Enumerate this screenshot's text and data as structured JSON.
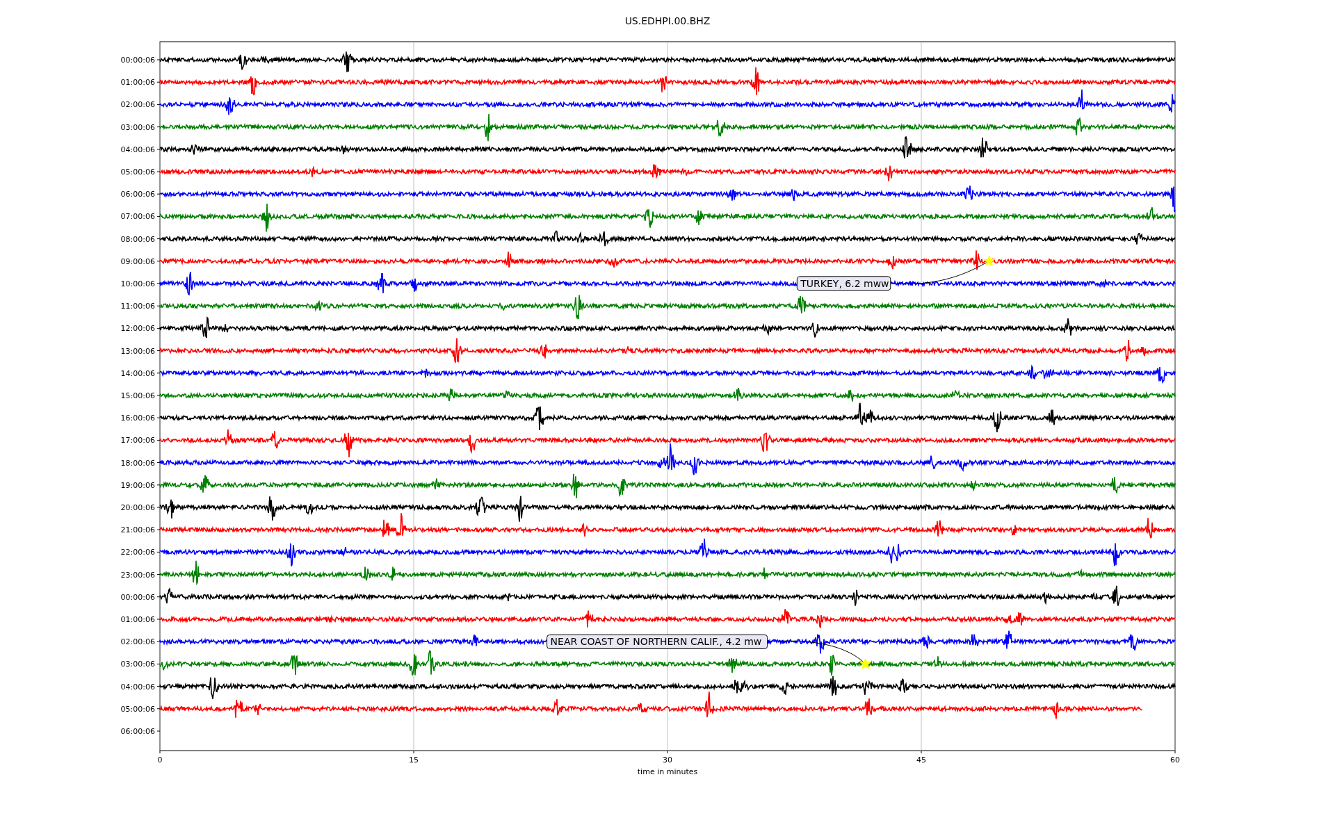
{
  "title": "US.EDHPI.00.BHZ",
  "rows": [
    {
      "label": "00:00:06",
      "color": "#000000",
      "level": 1
    },
    {
      "label": "01:00:06",
      "color": "#ff0000",
      "level": 1
    },
    {
      "label": "02:00:06",
      "color": "#0000ff",
      "level": 1
    },
    {
      "label": "03:00:06",
      "color": "#008000",
      "level": 1
    },
    {
      "label": "04:00:06",
      "color": "#000000",
      "level": 1
    },
    {
      "label": "05:00:06",
      "color": "#ff0000",
      "level": 1
    },
    {
      "label": "06:00:06",
      "color": "#0000ff",
      "level": 1
    },
    {
      "label": "07:00:06",
      "color": "#008000",
      "level": 1
    },
    {
      "label": "08:00:06",
      "color": "#000000",
      "level": 1
    },
    {
      "label": "09:00:06",
      "color": "#ff0000",
      "level": 1,
      "event": {
        "label": "TURKEY, 6.2 mww",
        "level": 0.817
      }
    },
    {
      "label": "10:00:06",
      "color": "#0000ff",
      "level": 1
    },
    {
      "label": "11:00:06",
      "color": "#008000",
      "level": 1
    },
    {
      "label": "12:00:06",
      "color": "#000000",
      "level": 1
    },
    {
      "label": "13:00:06",
      "color": "#ff0000",
      "level": 1
    },
    {
      "label": "14:00:06",
      "color": "#0000ff",
      "level": 1
    },
    {
      "label": "15:00:06",
      "color": "#008000",
      "level": 1
    },
    {
      "label": "16:00:06",
      "color": "#000000",
      "level": 1
    },
    {
      "label": "17:00:06",
      "color": "#ff0000",
      "level": 1
    },
    {
      "label": "18:00:06",
      "color": "#0000ff",
      "level": 1
    },
    {
      "label": "19:00:06",
      "color": "#008000",
      "level": 1
    },
    {
      "label": "20:00:06",
      "color": "#000000",
      "level": 1
    },
    {
      "label": "21:00:06",
      "color": "#ff0000",
      "level": 1
    },
    {
      "label": "22:00:06",
      "color": "#0000ff",
      "level": 1
    },
    {
      "label": "23:00:06",
      "color": "#008000",
      "level": 1
    },
    {
      "label": "00:00:06",
      "color": "#000000",
      "level": 1
    },
    {
      "label": "01:00:06",
      "color": "#ff0000",
      "level": 1
    },
    {
      "label": "02:00:06",
      "color": "#0000ff",
      "level": 1
    },
    {
      "label": "03:00:06",
      "color": "#008000",
      "level": 1,
      "event": {
        "label": "NEAR COAST OF NORTHERN CALIF., 4.2 mw",
        "level": 0.695
      }
    },
    {
      "label": "04:00:06",
      "color": "#000000",
      "level": 1
    },
    {
      "label": "05:00:06",
      "color": "#ff0000",
      "level": 0.968
    },
    {
      "label": "06:00:06"
    }
  ],
  "xaxis": {
    "label": "time in minutes",
    "ticks": [
      "0",
      "15",
      "30",
      "45",
      "60"
    ]
  }
}
